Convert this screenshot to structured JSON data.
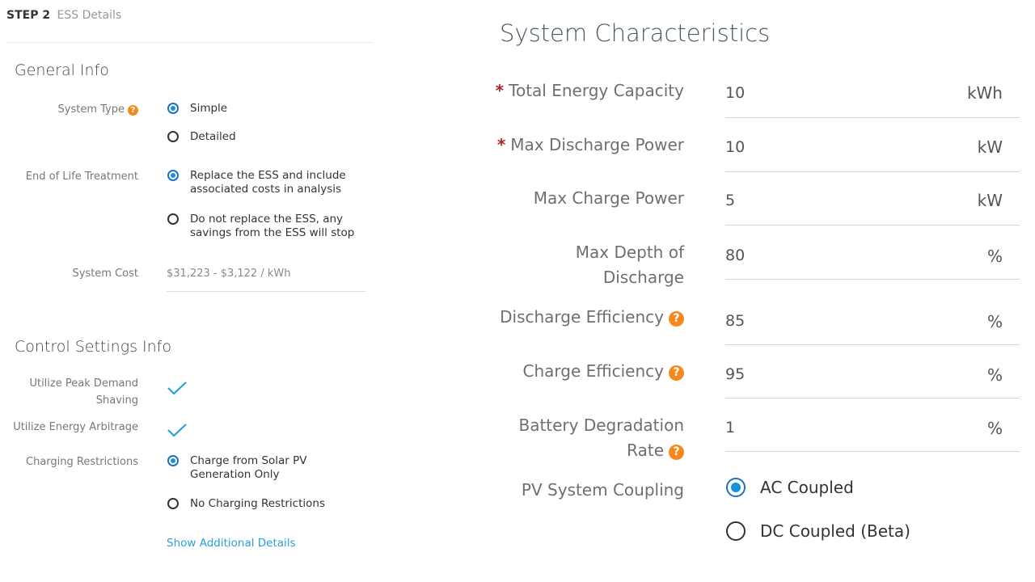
{
  "step": {
    "number": "STEP 2",
    "name": "ESS Details"
  },
  "general_info": {
    "title": "General Info",
    "system_type": {
      "label": "System Type",
      "options": [
        "Simple",
        "Detailed"
      ],
      "selected": "Simple"
    },
    "end_of_life": {
      "label": "End of Life Treatment",
      "options": [
        [
          "Replace the ESS and include",
          "associated costs in analysis"
        ],
        [
          "Do not replace the ESS, any",
          "savings from the ESS will stop"
        ]
      ],
      "selected": 0
    },
    "system_cost": {
      "label": "System Cost",
      "value": "$31,223 - $3,122 / kWh"
    }
  },
  "control_settings": {
    "title": "Control Settings Info",
    "peak_demand": {
      "label_line1": "Utilize Peak Demand",
      "label_line2": "Shaving",
      "checked": true
    },
    "energy_arbitrage": {
      "label": "Utilize Energy Arbitrage",
      "checked": true
    },
    "charging_restrictions": {
      "label": "Charging Restrictions",
      "options": [
        [
          "Charge from Solar PV",
          "Generation Only"
        ],
        [
          "No Charging Restrictions"
        ]
      ],
      "selected": 0
    },
    "show_more": "Show Additional Details"
  },
  "system_characteristics": {
    "title": "System Characteristics",
    "fields": [
      {
        "label": "Total Energy Capacity",
        "value": "10",
        "unit": "kWh",
        "required": true
      },
      {
        "label": "Max Discharge Power",
        "value": "10",
        "unit": "kW",
        "required": true
      },
      {
        "label": "Max Charge Power",
        "value": "5",
        "unit": "kW"
      },
      {
        "label_line1": "Max Depth of",
        "label_line2": "Discharge",
        "value": "80",
        "unit": "%"
      },
      {
        "label": "Discharge Efficiency",
        "value": "85",
        "unit": "%",
        "help": true
      },
      {
        "label": "Charge Efficiency",
        "value": "95",
        "unit": "%",
        "help": true
      },
      {
        "label_line1": "Battery Degradation",
        "label_line2": "Rate",
        "value": "1",
        "unit": "%",
        "help": true
      }
    ],
    "pv_coupling": {
      "label": "PV System Coupling",
      "options": [
        "AC Coupled",
        "DC Coupled (Beta)"
      ],
      "selected": "AC Coupled"
    }
  },
  "colors": {
    "accent": "#1592dc",
    "help": "#f5891f",
    "required": "#b0222a",
    "link": "#2a9fd8"
  },
  "icons": {
    "help": "question-circle-icon",
    "check": "checkmark-icon"
  }
}
